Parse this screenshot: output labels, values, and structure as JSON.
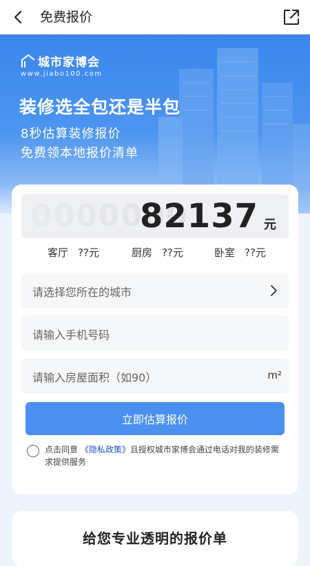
{
  "header": {
    "title": "免费报价",
    "back_icon": "chevron-left-icon",
    "share_icon": "share-external-icon"
  },
  "hero": {
    "logo_name": "城市家博会",
    "logo_url": "www.jiabo100.com",
    "title": "装修选全包还是半包",
    "subtitle_1": "8秒估算装修报价",
    "subtitle_2": "免费领本地报价清单",
    "accent_color": "#3a86ec"
  },
  "estimate": {
    "placeholder_digits": "0000000",
    "value": "82137",
    "unit": "元",
    "rooms": [
      {
        "label": "客厅",
        "value": "??元"
      },
      {
        "label": "厨房",
        "value": "??元"
      },
      {
        "label": "卧室",
        "value": "??元"
      }
    ]
  },
  "form": {
    "city_placeholder": "请选择您所在的城市",
    "phone_placeholder": "请输入手机号码",
    "area_placeholder": "请输入房屋面积（如90）",
    "area_unit": "m²",
    "submit_label": "立即估算报价",
    "button_color": "#4b90f0"
  },
  "agreement": {
    "prefix": "点击同意",
    "link": "《隐私政策》",
    "suffix": "且授权城市家博会通过电话对我的装修需求提供服务"
  },
  "section2": {
    "title": "给您专业透明的报价单"
  }
}
